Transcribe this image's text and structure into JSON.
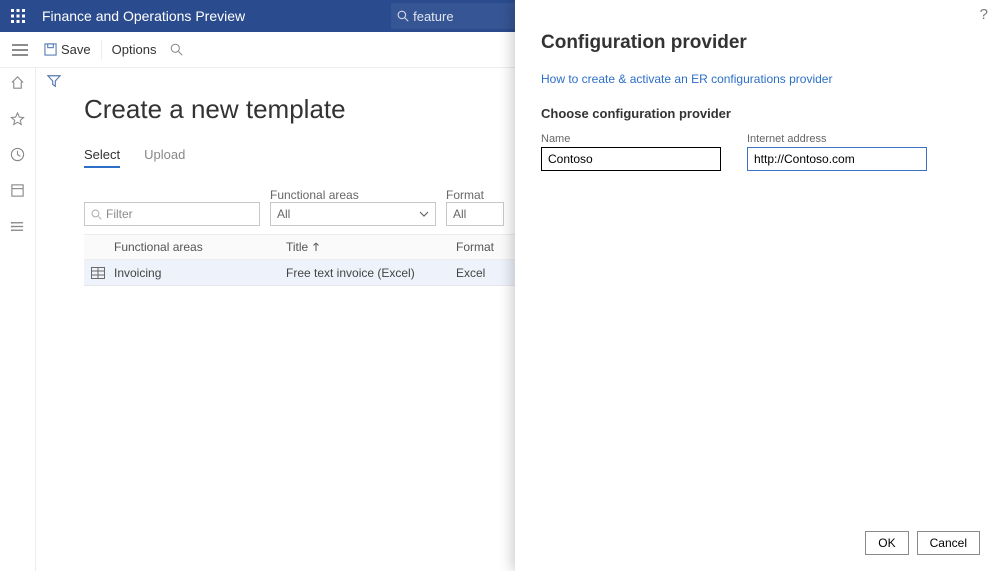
{
  "header": {
    "app_title": "Finance and Operations Preview",
    "search_text": "feature"
  },
  "action_bar": {
    "save": "Save",
    "options": "Options"
  },
  "page": {
    "title": "Create a new template",
    "tabs": [
      "Select",
      "Upload"
    ],
    "filter_placeholder": "Filter",
    "filters": {
      "functional_areas_label": "Functional areas",
      "format_label": "Format",
      "all": "All"
    },
    "grid": {
      "headers": {
        "functional_areas": "Functional areas",
        "title": "Title",
        "format": "Format"
      },
      "rows": [
        {
          "fa": "Invoicing",
          "title": "Free text invoice (Excel)",
          "format": "Excel"
        }
      ]
    }
  },
  "panel": {
    "title": "Configuration provider",
    "link": "How to create & activate an ER configurations provider",
    "subtitle": "Choose configuration provider",
    "name_label": "Name",
    "name_value": "Contoso",
    "url_label": "Internet address",
    "url_value": "http://Contoso.com",
    "ok": "OK",
    "cancel": "Cancel"
  }
}
